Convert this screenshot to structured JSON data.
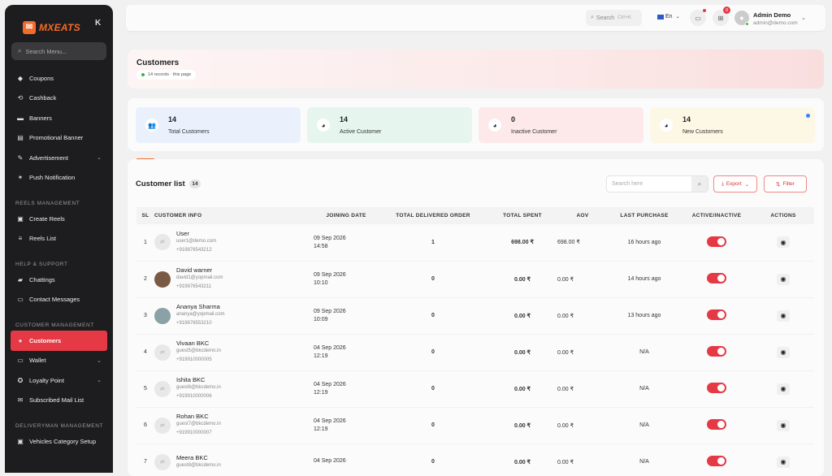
{
  "sidebar": {
    "brand": "MXEATS",
    "logo_glyph": "✉",
    "collapse_glyph": "K",
    "search_placeholder": "Search Menu...",
    "items_top": [
      {
        "label": "Coupons",
        "icon": "coupon-icon",
        "glyph": "◆"
      },
      {
        "label": "Cashback",
        "icon": "cashback-icon",
        "glyph": "⟲"
      },
      {
        "label": "Banners",
        "icon": "banner-icon",
        "glyph": "▬"
      },
      {
        "label": "Promotional Banner",
        "icon": "promo-banner-icon",
        "glyph": "▤"
      },
      {
        "label": "Advertisement",
        "icon": "advertisement-icon",
        "glyph": "✎",
        "expand": true
      },
      {
        "label": "Push Notification",
        "icon": "bell-icon",
        "glyph": "✶"
      }
    ],
    "section_reels": "REELS MANAGEMENT",
    "items_reels": [
      {
        "label": "Create Reels",
        "icon": "create-reels-icon",
        "glyph": "▣"
      },
      {
        "label": "Reels List",
        "icon": "list-icon",
        "glyph": "≡"
      }
    ],
    "section_help": "HELP & SUPPORT",
    "items_help": [
      {
        "label": "Chattings",
        "icon": "chat-icon",
        "glyph": "▰"
      },
      {
        "label": "Contact Messages",
        "icon": "message-icon",
        "glyph": "▭"
      }
    ],
    "section_customer": "CUSTOMER MANAGEMENT",
    "items_customer": [
      {
        "label": "Customers",
        "icon": "customer-icon",
        "glyph": "●",
        "active": true
      },
      {
        "label": "Wallet",
        "icon": "wallet-icon",
        "glyph": "▭",
        "expand": true
      },
      {
        "label": "Loyalty Point",
        "icon": "loyalty-icon",
        "glyph": "✪",
        "expand": true
      },
      {
        "label": "Subscribed Mail List",
        "icon": "mail-icon",
        "glyph": "✉"
      }
    ],
    "section_delivery": "DELIVERYMAN MANAGEMENT",
    "items_delivery": [
      {
        "label": "Vehicles Category Setup",
        "icon": "vehicle-icon",
        "glyph": "▣"
      }
    ]
  },
  "topbar": {
    "search_label": "Search",
    "search_shortcut": "Ctrl+K",
    "language": "En",
    "cart_count": "0",
    "admin_name": "Admin Demo",
    "admin_email": "admin@demo.com"
  },
  "header": {
    "title": "Customers",
    "records": "14 records · this page"
  },
  "stats": [
    {
      "value": "14",
      "label": "Total Customers",
      "bg": "#eaf1fd",
      "glyph": "👥"
    },
    {
      "value": "14",
      "label": "Active Customer",
      "bg": "#e6f6ef",
      "glyph": "◕"
    },
    {
      "value": "0",
      "label": "Inactive Customer",
      "bg": "#fde9e9",
      "glyph": "◕"
    },
    {
      "value": "14",
      "label": "New Customers",
      "bg": "#fdf7e6",
      "glyph": "◕"
    }
  ],
  "table": {
    "title": "Customer list",
    "count": "14",
    "search_placeholder": "Search here",
    "export_label": "Export",
    "filter_label": "Filter",
    "columns": [
      "SL",
      "CUSTOMER INFO",
      "JOINING DATE",
      "TOTAL DELIVERED ORDER",
      "TOTAL SPENT",
      "AOV",
      "LAST PURCHASE",
      "ACTIVE/INACTIVE",
      "ACTIONS"
    ],
    "rows": [
      {
        "sl": "1",
        "name": "User",
        "email": "user1@demo.com",
        "phone": "+919876543212",
        "date": "09 Sep 2026",
        "time": "14:58",
        "orders": "1",
        "spent": "698.00 ₹",
        "aov": "698.00 ₹",
        "last": "16 hours ago",
        "avatar": "placeholder"
      },
      {
        "sl": "2",
        "name": "David warner",
        "email": "david1@yopmail.com",
        "phone": "+919876543211",
        "date": "09 Sep 2026",
        "time": "10:10",
        "orders": "0",
        "spent": "0.00 ₹",
        "aov": "0.00 ₹",
        "last": "14 hours ago",
        "avatar": "photo1"
      },
      {
        "sl": "3",
        "name": "Ananya Sharma",
        "email": "ananya@yopmail.com",
        "phone": "+919876553210",
        "date": "09 Sep 2026",
        "time": "10:09",
        "orders": "0",
        "spent": "0.00 ₹",
        "aov": "0.00 ₹",
        "last": "13 hours ago",
        "avatar": "photo2"
      },
      {
        "sl": "4",
        "name": "Vivaan BKC",
        "email": "guest5@bkcdemo.in",
        "phone": "+919910000005",
        "date": "04 Sep 2026",
        "time": "12:19",
        "orders": "0",
        "spent": "0.00 ₹",
        "aov": "0.00 ₹",
        "last": "N/A",
        "avatar": "placeholder"
      },
      {
        "sl": "5",
        "name": "Ishita BKC",
        "email": "guest6@bkcdemo.in",
        "phone": "+919910000006",
        "date": "04 Sep 2026",
        "time": "12:19",
        "orders": "0",
        "spent": "0.00 ₹",
        "aov": "0.00 ₹",
        "last": "N/A",
        "avatar": "placeholder"
      },
      {
        "sl": "6",
        "name": "Rohan BKC",
        "email": "guest7@bkcdemo.in",
        "phone": "+919910000007",
        "date": "04 Sep 2026",
        "time": "12:19",
        "orders": "0",
        "spent": "0.00 ₹",
        "aov": "0.00 ₹",
        "last": "N/A",
        "avatar": "placeholder"
      },
      {
        "sl": "7",
        "name": "Meera BKC",
        "email": "guest8@bkcdemo.in",
        "phone": "",
        "date": "04 Sep 2026",
        "time": "",
        "orders": "0",
        "spent": "0.00 ₹",
        "aov": "0.00 ₹",
        "last": "N/A",
        "avatar": "placeholder"
      }
    ],
    "avatar_text": "pit"
  },
  "colors": {
    "accent": "#e53945",
    "brand": "#f26b2a",
    "sidebar_bg": "#1d1d1f"
  }
}
